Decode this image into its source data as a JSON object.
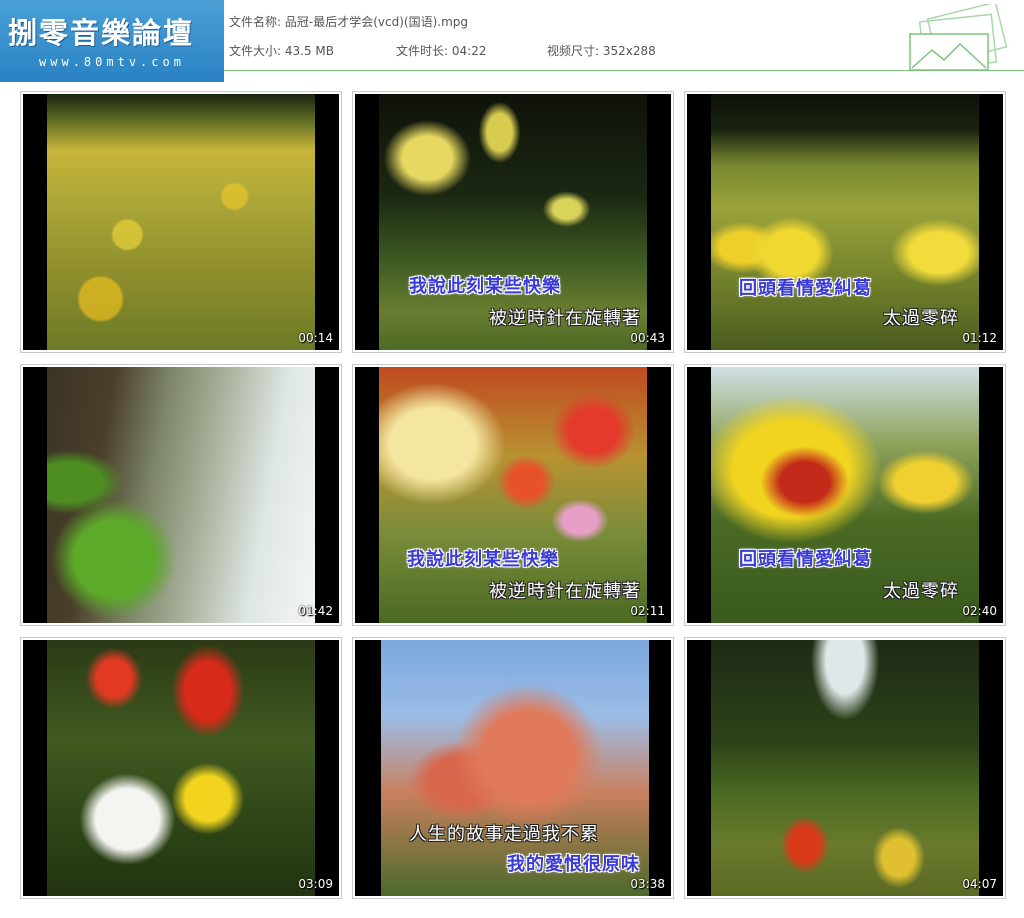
{
  "logo": {
    "title": "捌零音樂論壇",
    "url": "www.80mtv.com"
  },
  "file": {
    "name_label": "文件名称:",
    "name": "品冠-最后才学会(vcd)(国语).mpg",
    "size_label": "文件大小:",
    "size": "43.5 MB",
    "duration_label": "文件时长:",
    "duration": "04:22",
    "dims_label": "视频尺寸:",
    "dims": "352x288"
  },
  "thumbnails": [
    {
      "time": "00:14",
      "subtitle1": "",
      "subtitle2": ""
    },
    {
      "time": "00:43",
      "subtitle1": "我說此刻某些快樂",
      "subtitle2": "被逆時針在旋轉著"
    },
    {
      "time": "01:12",
      "subtitle1": "回頭看情愛糾葛",
      "subtitle2": "太過零碎"
    },
    {
      "time": "01:42",
      "subtitle1": "",
      "subtitle2": ""
    },
    {
      "time": "02:11",
      "subtitle1": "我說此刻某些快樂",
      "subtitle2": "被逆時針在旋轉著"
    },
    {
      "time": "02:40",
      "subtitle1": "回頭看情愛糾葛",
      "subtitle2": "太過零碎"
    },
    {
      "time": "03:09",
      "subtitle1": "",
      "subtitle2": ""
    },
    {
      "time": "03:38",
      "subtitle1": "人生的故事走過我不累",
      "subtitle2": "我的愛恨很原味"
    },
    {
      "time": "04:07",
      "subtitle1": "",
      "subtitle2": ""
    }
  ]
}
